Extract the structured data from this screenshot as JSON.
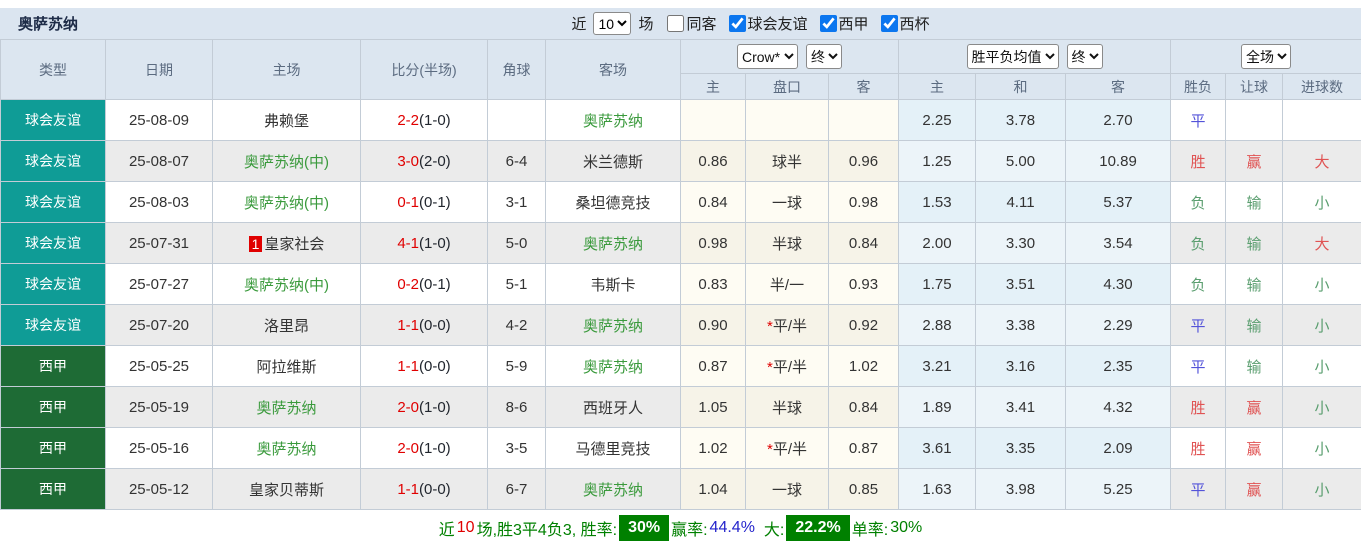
{
  "header": {
    "team_title": "奥萨苏纳",
    "recent_label": "近",
    "recent_value": "10",
    "matches_label": "场",
    "same_venue_label": "同客",
    "same_venue_checked": false,
    "filters": [
      {
        "label": "球会友谊",
        "checked": true
      },
      {
        "label": "西甲",
        "checked": true
      },
      {
        "label": "西杯",
        "checked": true
      }
    ]
  },
  "table": {
    "main_columns": [
      "类型",
      "日期",
      "主场",
      "比分(半场)",
      "角球",
      "客场"
    ],
    "sub_columns": [
      "主",
      "盘口",
      "客",
      "主",
      "和",
      "客",
      "胜负",
      "让球",
      "进球数"
    ],
    "dropdowns": {
      "odds_company": "Crow*",
      "odds_state": "终",
      "mean": "胜平负均值",
      "mean_state": "终",
      "scope": "全场"
    },
    "outcome_colors": {
      "胜": "#e05353",
      "平": "#5353d9",
      "负": "#5a9e6f",
      "赢": "#e05353",
      "输": "#5a9e6f",
      "大": "#e05353",
      "小": "#5a9e6f"
    },
    "type_colors": {
      "球会友谊": "#0f9c96",
      "西甲": "#1e6b35"
    },
    "rows": [
      {
        "type": "球会友谊",
        "date": "25-08-09",
        "home": "弗赖堡",
        "home_green": false,
        "home_badge": "",
        "score_ft": "2-2",
        "score_ht": "(1-0)",
        "corners": "",
        "away": "奥萨苏纳",
        "away_green": true,
        "crow_home": "",
        "handicap": "",
        "handicap_star": false,
        "crow_away": "",
        "mean_home": "2.25",
        "mean_draw": "3.78",
        "mean_away": "2.70",
        "outcome": "平",
        "handicap_outcome": "",
        "goals_outcome": ""
      },
      {
        "type": "球会友谊",
        "date": "25-08-07",
        "home": "奥萨苏纳(中)",
        "home_green": true,
        "home_badge": "",
        "score_ft": "3-0",
        "score_ht": "(2-0)",
        "corners": "6-4",
        "away": "米兰德斯",
        "away_green": false,
        "crow_home": "0.86",
        "handicap": "球半",
        "handicap_star": false,
        "crow_away": "0.96",
        "mean_home": "1.25",
        "mean_draw": "5.00",
        "mean_away": "10.89",
        "outcome": "胜",
        "handicap_outcome": "赢",
        "goals_outcome": "大"
      },
      {
        "type": "球会友谊",
        "date": "25-08-03",
        "home": "奥萨苏纳(中)",
        "home_green": true,
        "home_badge": "",
        "score_ft": "0-1",
        "score_ht": "(0-1)",
        "corners": "3-1",
        "away": "桑坦德竞技",
        "away_green": false,
        "crow_home": "0.84",
        "handicap": "一球",
        "handicap_star": false,
        "crow_away": "0.98",
        "mean_home": "1.53",
        "mean_draw": "4.11",
        "mean_away": "5.37",
        "outcome": "负",
        "handicap_outcome": "输",
        "goals_outcome": "小"
      },
      {
        "type": "球会友谊",
        "date": "25-07-31",
        "home": "皇家社会",
        "home_green": false,
        "home_badge": "1",
        "score_ft": "4-1",
        "score_ht": "(1-0)",
        "corners": "5-0",
        "away": "奥萨苏纳",
        "away_green": true,
        "crow_home": "0.98",
        "handicap": "半球",
        "handicap_star": false,
        "crow_away": "0.84",
        "mean_home": "2.00",
        "mean_draw": "3.30",
        "mean_away": "3.54",
        "outcome": "负",
        "handicap_outcome": "输",
        "goals_outcome": "大"
      },
      {
        "type": "球会友谊",
        "date": "25-07-27",
        "home": "奥萨苏纳(中)",
        "home_green": true,
        "home_badge": "",
        "score_ft": "0-2",
        "score_ht": "(0-1)",
        "corners": "5-1",
        "away": "韦斯卡",
        "away_green": false,
        "crow_home": "0.83",
        "handicap": "半/一",
        "handicap_star": false,
        "crow_away": "0.93",
        "mean_home": "1.75",
        "mean_draw": "3.51",
        "mean_away": "4.30",
        "outcome": "负",
        "handicap_outcome": "输",
        "goals_outcome": "小"
      },
      {
        "type": "球会友谊",
        "date": "25-07-20",
        "home": "洛里昂",
        "home_green": false,
        "home_badge": "",
        "score_ft": "1-1",
        "score_ht": "(0-0)",
        "corners": "4-2",
        "away": "奥萨苏纳",
        "away_green": true,
        "crow_home": "0.90",
        "handicap": "平/半",
        "handicap_star": true,
        "crow_away": "0.92",
        "mean_home": "2.88",
        "mean_draw": "3.38",
        "mean_away": "2.29",
        "outcome": "平",
        "handicap_outcome": "输",
        "goals_outcome": "小"
      },
      {
        "type": "西甲",
        "date": "25-05-25",
        "home": "阿拉维斯",
        "home_green": false,
        "home_badge": "",
        "score_ft": "1-1",
        "score_ht": "(0-0)",
        "corners": "5-9",
        "away": "奥萨苏纳",
        "away_green": true,
        "crow_home": "0.87",
        "handicap": "平/半",
        "handicap_star": true,
        "crow_away": "1.02",
        "mean_home": "3.21",
        "mean_draw": "3.16",
        "mean_away": "2.35",
        "outcome": "平",
        "handicap_outcome": "输",
        "goals_outcome": "小"
      },
      {
        "type": "西甲",
        "date": "25-05-19",
        "home": "奥萨苏纳",
        "home_green": true,
        "home_badge": "",
        "score_ft": "2-0",
        "score_ht": "(1-0)",
        "corners": "8-6",
        "away": "西班牙人",
        "away_green": false,
        "crow_home": "1.05",
        "handicap": "半球",
        "handicap_star": false,
        "crow_away": "0.84",
        "mean_home": "1.89",
        "mean_draw": "3.41",
        "mean_away": "4.32",
        "outcome": "胜",
        "handicap_outcome": "赢",
        "goals_outcome": "小"
      },
      {
        "type": "西甲",
        "date": "25-05-16",
        "home": "奥萨苏纳",
        "home_green": true,
        "home_badge": "",
        "score_ft": "2-0",
        "score_ht": "(1-0)",
        "corners": "3-5",
        "away": "马德里竞技",
        "away_green": false,
        "crow_home": "1.02",
        "handicap": "平/半",
        "handicap_star": true,
        "crow_away": "0.87",
        "mean_home": "3.61",
        "mean_draw": "3.35",
        "mean_away": "2.09",
        "outcome": "胜",
        "handicap_outcome": "赢",
        "goals_outcome": "小"
      },
      {
        "type": "西甲",
        "date": "25-05-12",
        "home": "皇家贝蒂斯",
        "home_green": false,
        "home_badge": "",
        "score_ft": "1-1",
        "score_ht": "(0-0)",
        "corners": "6-7",
        "away": "奥萨苏纳",
        "away_green": true,
        "crow_home": "1.04",
        "handicap": "一球",
        "handicap_star": false,
        "crow_away": "0.85",
        "mean_home": "1.63",
        "mean_draw": "3.98",
        "mean_away": "5.25",
        "outcome": "平",
        "handicap_outcome": "赢",
        "goals_outcome": "小"
      }
    ]
  },
  "summary": {
    "prefix_label": "近",
    "recent_count": "10",
    "stats_text": "场,胜3平4负3, 胜率:",
    "win_rate": "30%",
    "win_odds_label": "赢率:",
    "win_odds_rate": "44.4%",
    "big_label": "大:",
    "big_rate": "22.2%",
    "single_label": "单率:",
    "single_rate": "30%"
  }
}
